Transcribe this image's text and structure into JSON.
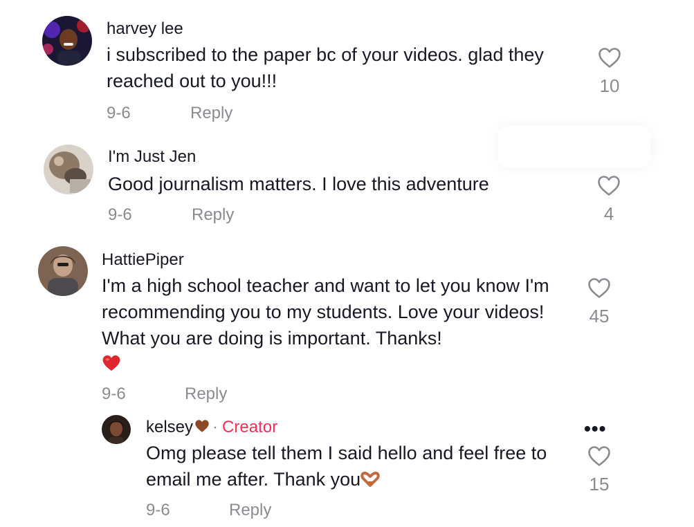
{
  "comments": [
    {
      "username": "harvey lee",
      "text": "i subscribed to the paper bc of your videos. glad they reached out to you!!!",
      "date": "9-6",
      "reply_label": "Reply",
      "likes": "10"
    },
    {
      "username": "I'm Just Jen",
      "text": "Good journalism matters. I love this adventure",
      "date": "9-6",
      "reply_label": "Reply",
      "likes": "4"
    },
    {
      "username": "HattiePiper",
      "text": "I'm a high school teacher and want to let you know I'm recommending you to my students. Love your videos! What you are doing is important. Thanks!",
      "emoji": "red-heart",
      "date": "9-6",
      "reply_label": "Reply",
      "likes": "45"
    }
  ],
  "reply": {
    "username": "kelsey",
    "username_emoji": "brown-heart",
    "separator": "·",
    "creator_label": "Creator",
    "text": "Omg please tell them I said hello and feel free to email me after. Thank you",
    "text_emoji": "heart-hands",
    "date": "9-6",
    "reply_label": "Reply",
    "likes": "15",
    "more_label": "•••"
  },
  "icons": {
    "like": "heart-outline-icon",
    "more": "more-dots-icon"
  },
  "colors": {
    "text": "#161823",
    "muted": "#8a8b91",
    "creator": "#fe2c55",
    "heart_emoji": "#e0262e",
    "brown_heart": "#8b4a25"
  }
}
